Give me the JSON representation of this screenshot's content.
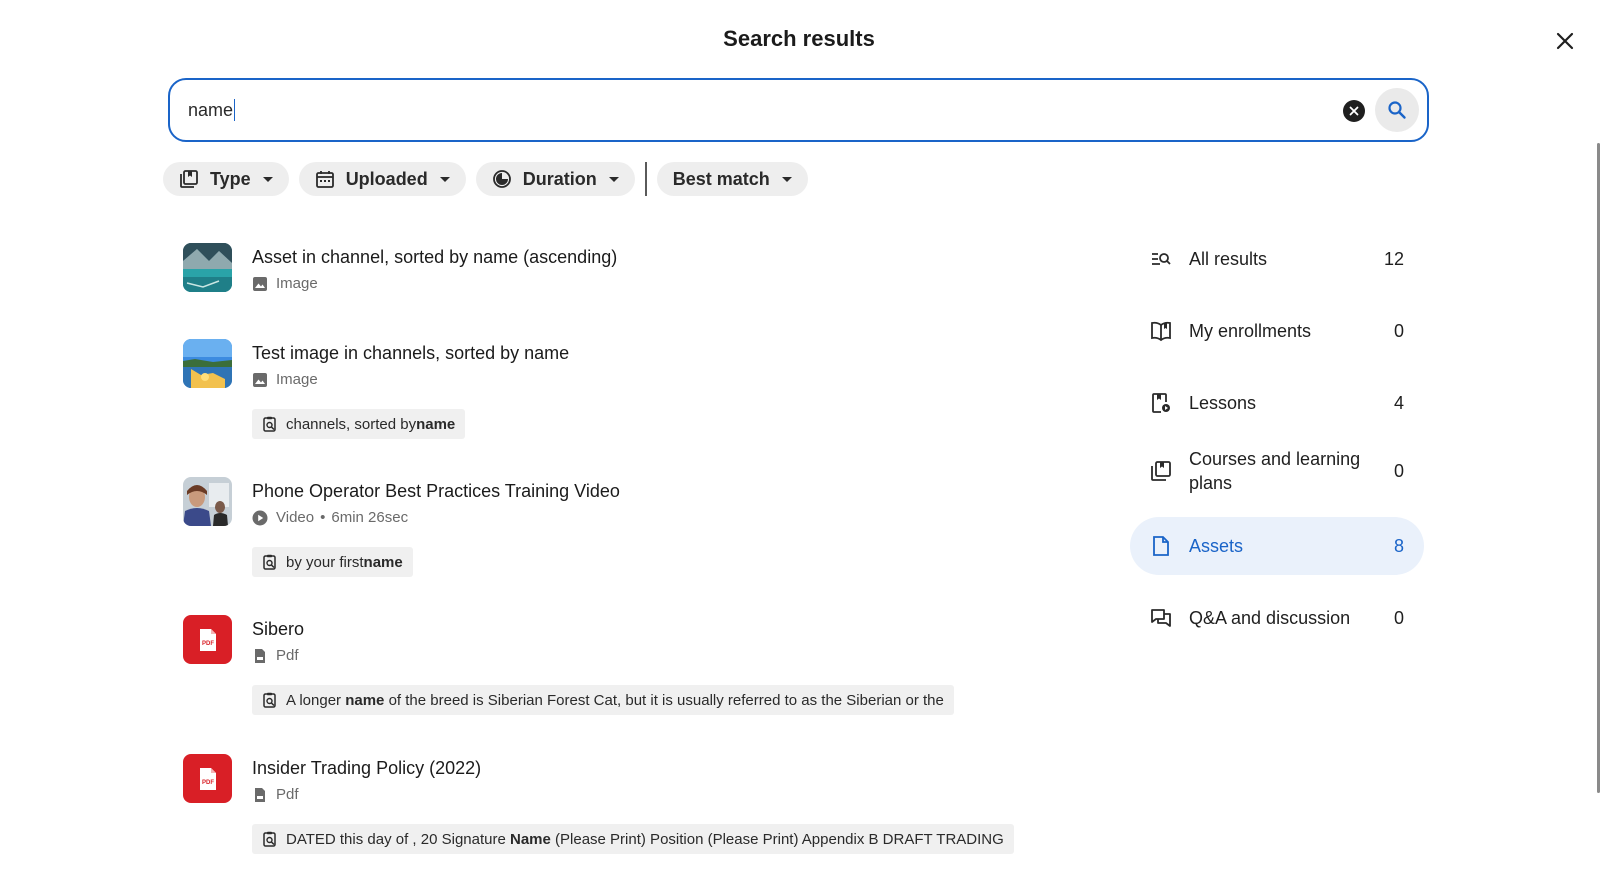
{
  "page": {
    "title": "Search results"
  },
  "search": {
    "value": "name"
  },
  "filters": [
    {
      "label": "Type",
      "icon": "library-icon"
    },
    {
      "label": "Uploaded",
      "icon": "calendar-icon"
    },
    {
      "label": "Duration",
      "icon": "timer-icon"
    },
    {
      "label": "Best match",
      "icon": ""
    }
  ],
  "results": [
    {
      "title": "Asset in channel, sorted by name (ascending)",
      "type": "Image",
      "thumb": "lake-photo",
      "snippet_prefix": "",
      "snippet_bold": "",
      "snippet_suffix": ""
    },
    {
      "title": "Test image in channels, sorted by name",
      "type": "Image",
      "thumb": "beach-photo",
      "snippet_prefix": "channels, sorted by ",
      "snippet_bold": "name",
      "snippet_suffix": ""
    },
    {
      "title": "Phone Operator Best Practices Training Video",
      "type": "Video",
      "duration": "6min 26sec",
      "thumb": "office-photo",
      "snippet_prefix": "by your first ",
      "snippet_bold": "name",
      "snippet_suffix": ""
    },
    {
      "title": "Sibero",
      "type": "Pdf",
      "thumb": "pdf",
      "snippet_prefix": "A longer ",
      "snippet_bold": "name",
      "snippet_suffix": " of the breed is Siberian Forest Cat, but it is usually referred to as the Siberian or the"
    },
    {
      "title": "Insider Trading Policy (2022)",
      "type": "Pdf",
      "thumb": "pdf",
      "snippet_prefix": "DATED this day of , 20 Signature ",
      "snippet_bold": "Name",
      "snippet_suffix": " (Please Print) Position (Please Print) Appendix B DRAFT TRADING"
    }
  ],
  "sidebar": [
    {
      "label": "All results",
      "count": "12",
      "icon": "search-list-icon",
      "active": false
    },
    {
      "label": "My enrollments",
      "count": "0",
      "icon": "open-book-icon",
      "active": false
    },
    {
      "label": "Lessons",
      "count": "4",
      "icon": "lesson-icon",
      "active": false
    },
    {
      "label": "Courses and learning plans",
      "count": "0",
      "icon": "library-icon",
      "active": false
    },
    {
      "label": "Assets",
      "count": "8",
      "icon": "file-icon",
      "active": true
    },
    {
      "label": "Q&A and discussion",
      "count": "0",
      "icon": "forum-icon",
      "active": false
    }
  ],
  "colors": {
    "accent": "#1a64c8",
    "pdf_red": "#d91f26",
    "active_bg": "#eaf1fb",
    "chip_bg": "#eeeeee"
  },
  "pdf_badge": "PDF",
  "separator": "•"
}
